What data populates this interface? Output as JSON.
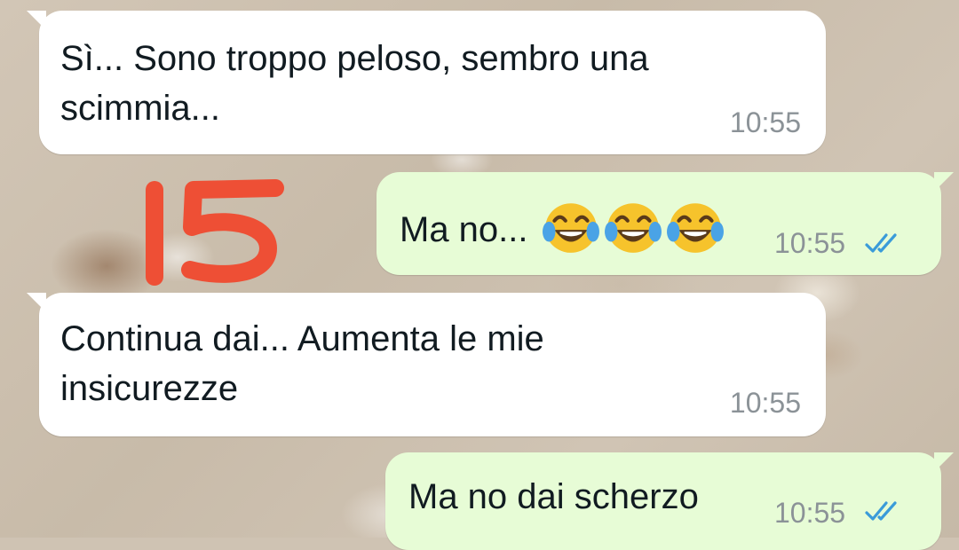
{
  "colors": {
    "incoming_bubble": "#ffffff",
    "outgoing_bubble": "#e7fcd6",
    "read_ticks": "#3a9bd9",
    "marker_number": "#ee4f35"
  },
  "annotation": {
    "number": "15"
  },
  "messages": [
    {
      "direction": "incoming",
      "text": "Sì... Sono troppo peloso, sembro una\nscimmia...",
      "time": "10:55"
    },
    {
      "direction": "outgoing",
      "text": "Ma no...",
      "emojis": [
        "face-with-tears-of-joy",
        "face-with-tears-of-joy",
        "face-with-tears-of-joy"
      ],
      "time": "10:55",
      "status": "read"
    },
    {
      "direction": "incoming",
      "text": "Continua dai... Aumenta le mie\ninsicurezze",
      "time": "10:55"
    },
    {
      "direction": "outgoing",
      "text": "Ma no dai scherzo",
      "time": "10:55",
      "status": "read"
    }
  ]
}
